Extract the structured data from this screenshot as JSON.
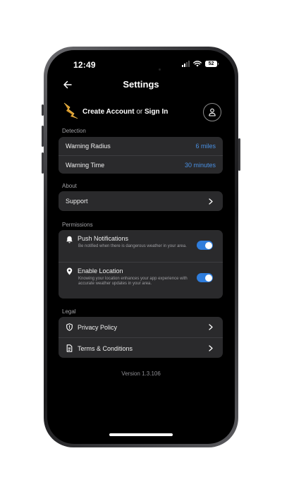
{
  "status_bar": {
    "time": "12:49",
    "battery": "52"
  },
  "nav": {
    "title": "Settings"
  },
  "account": {
    "create": "Create Account",
    "or": " or ",
    "sign_in": "Sign In"
  },
  "sections": {
    "detection": {
      "label": "Detection",
      "rows": [
        {
          "label": "Warning Radius",
          "value": "6 miles"
        },
        {
          "label": "Warning Time",
          "value": "30 minutes"
        }
      ]
    },
    "about": {
      "label": "About",
      "rows": [
        {
          "label": "Support"
        }
      ]
    },
    "permissions": {
      "label": "Permissions",
      "rows": [
        {
          "label": "Push Notifications",
          "description": "Be notified when there is dangerous weather in your area.",
          "enabled": true
        },
        {
          "label": "Enable Location",
          "description": "Knowing your location enhances your app experience with accurate weather updates in your area.",
          "enabled": true
        }
      ]
    },
    "legal": {
      "label": "Legal",
      "rows": [
        {
          "label": "Privacy Policy"
        },
        {
          "label": "Terms & Conditions"
        }
      ]
    }
  },
  "footer": {
    "version": "Version 1.3.106"
  },
  "colors": {
    "accent": "#2f7ddc",
    "value_text": "#4a90e2",
    "card_bg": "#2a2a2c",
    "logo": "#d99a2b"
  },
  "icons": [
    "back-arrow-icon",
    "lightning-logo-icon",
    "person-icon",
    "chevron-right-icon",
    "bell-icon",
    "location-pin-icon",
    "shield-icon",
    "document-icon",
    "wifi-icon",
    "signal-icon",
    "battery-icon"
  ]
}
